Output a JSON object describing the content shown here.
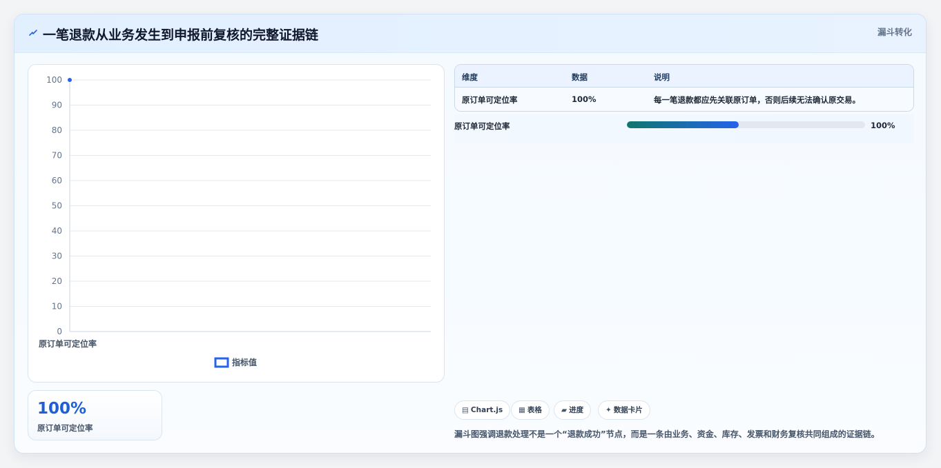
{
  "header": {
    "title": "一笔退款从业务发生到申报前复核的完整证据链",
    "tag": "漏斗转化",
    "bolt_color": "#2563eb"
  },
  "chart_data": {
    "type": "bar",
    "categories": [
      "原订单可定位率"
    ],
    "series": [
      {
        "name": "指标值",
        "values": [
          100
        ],
        "color": "#2563eb"
      }
    ],
    "ylim": [
      0,
      100
    ],
    "yticks": [
      0,
      10,
      20,
      30,
      40,
      50,
      60,
      70,
      80,
      90,
      100
    ],
    "grid": true,
    "legend": "bottom"
  },
  "kpi": {
    "value": "100%",
    "label": "原订单可定位率"
  },
  "table": {
    "headers": [
      "维度",
      "数据",
      "说明"
    ],
    "rows": [
      [
        "原订单可定位率",
        "100%",
        "每一笔退款都应先关联原订单，否则后续无法确认原交易。"
      ]
    ]
  },
  "progress": {
    "label": "原订单可定位率",
    "value_text": "100%",
    "fill_fraction": 0.47
  },
  "badges": [
    {
      "icon": "chart-icon",
      "glyph": "▤",
      "label": "Chart.js"
    },
    {
      "icon": "table-icon",
      "glyph": "▦",
      "label": "表格"
    },
    {
      "icon": "progress-icon",
      "glyph": "▰",
      "label": "进度"
    },
    {
      "icon": "sparkle-icon",
      "glyph": "✦",
      "label": "数据卡片"
    }
  ],
  "footnote": "漏斗图强调退款处理不是一个“退款成功”节点，而是一条由业务、资金、库存、发票和财务复核共同组成的证据链。"
}
